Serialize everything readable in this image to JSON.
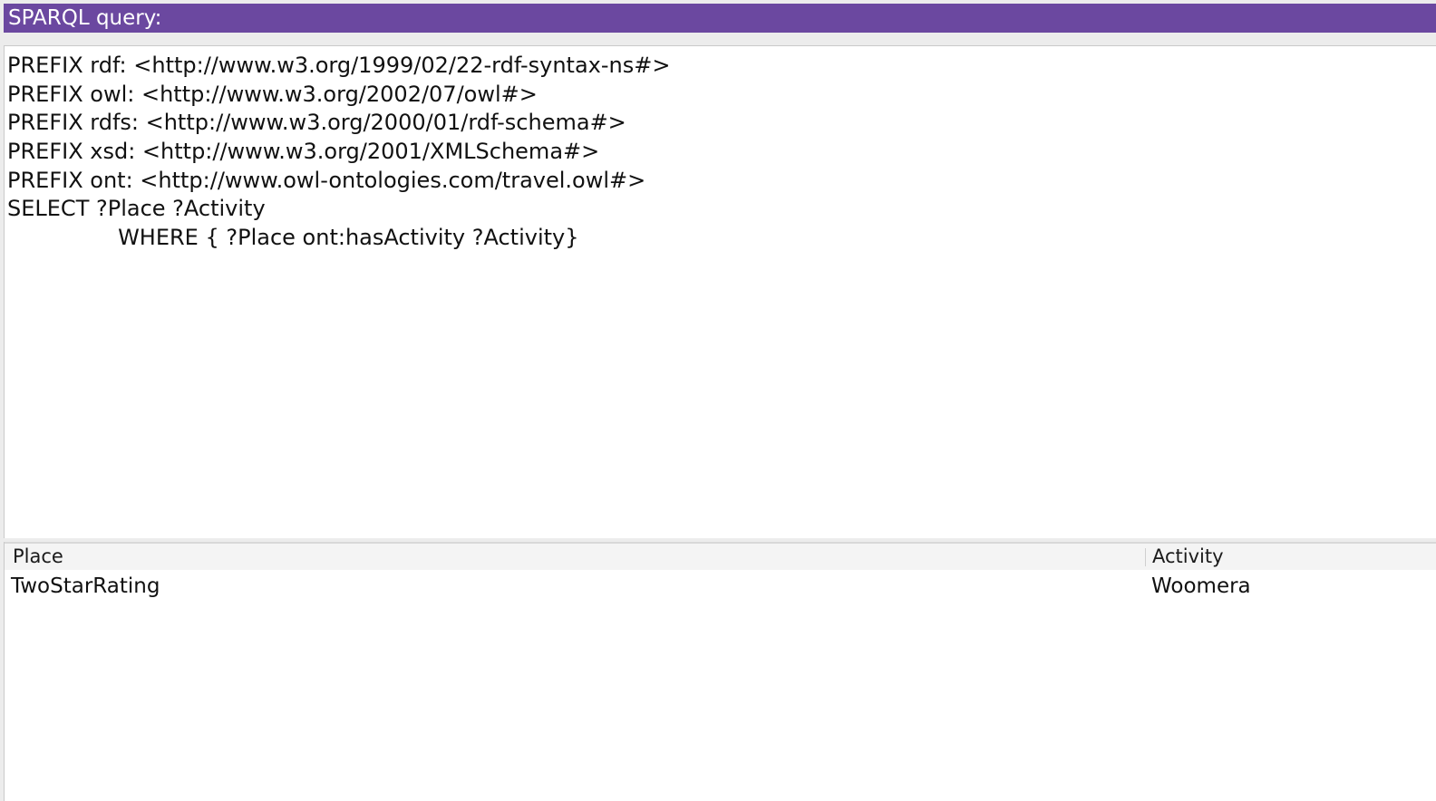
{
  "panel": {
    "title": "SPARQL query:"
  },
  "query": {
    "lines": [
      "PREFIX rdf: <http://www.w3.org/1999/02/22-rdf-syntax-ns#>",
      "PREFIX owl: <http://www.w3.org/2002/07/owl#>",
      "PREFIX rdfs: <http://www.w3.org/2000/01/rdf-schema#>",
      "PREFIX xsd: <http://www.w3.org/2001/XMLSchema#>",
      "PREFIX ont: <http://www.owl-ontologies.com/travel.owl#>",
      "SELECT ?Place ?Activity",
      "\t\tWHERE { ?Place ont:hasActivity ?Activity}"
    ]
  },
  "results": {
    "columns": [
      "Place",
      "Activity"
    ],
    "rows": [
      [
        "TwoStarRating",
        "Woomera"
      ]
    ]
  },
  "colors": {
    "title_bar": "#6b48a0",
    "title_text": "#ffffff",
    "background": "#ececec",
    "editor_background": "#ffffff"
  }
}
